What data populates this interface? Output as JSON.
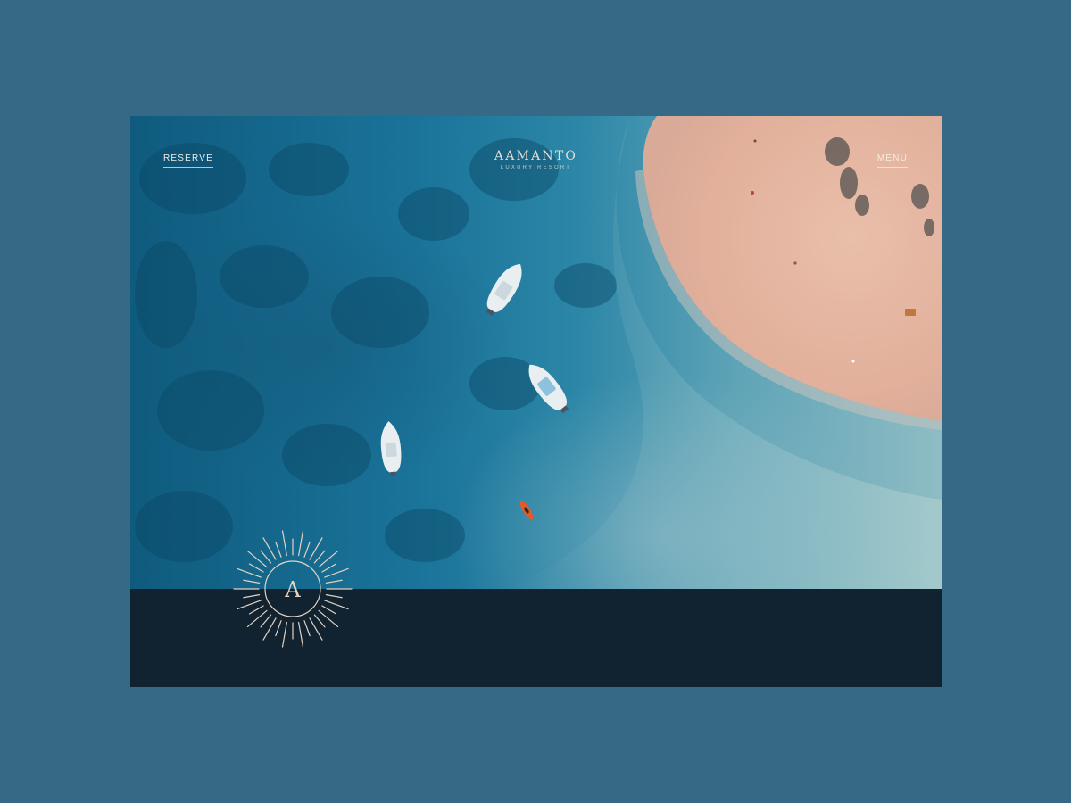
{
  "header": {
    "reserve_label": "RESERVE",
    "menu_label": "MENU",
    "brand_name": "AAMANTO",
    "brand_tagline": "LUXURY RESORT"
  },
  "emblem": {
    "letter": "A"
  },
  "colors": {
    "page_background": "#356985",
    "footer_bar": "#112330",
    "header_text": "#f3ece2",
    "emblem_line": "#e4d2c2",
    "sand": "#e4b5a0"
  }
}
